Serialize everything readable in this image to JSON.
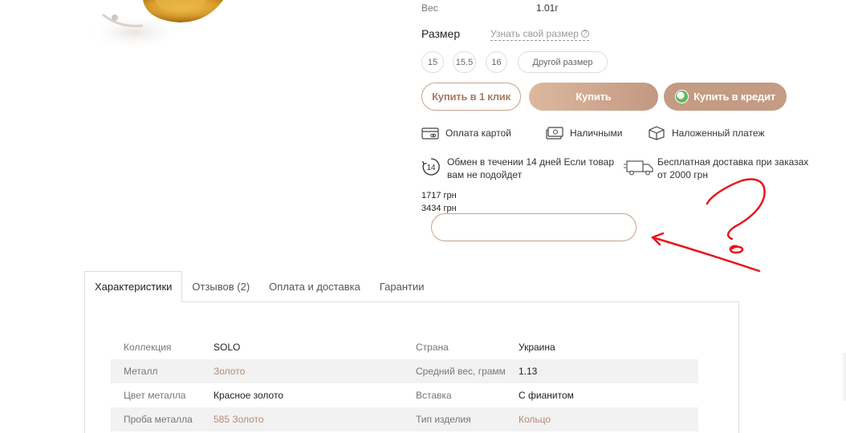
{
  "product": {
    "weight_label": "Вес",
    "weight_value": "1.01г"
  },
  "size": {
    "title": "Размер",
    "find_link": "Узнать свой размер",
    "options": [
      "15",
      "15.5",
      "16",
      "Другой размер"
    ]
  },
  "buttons": {
    "one_click": "Купить в 1 клик",
    "buy": "Купить",
    "credit": "Купить в кредит"
  },
  "payment": {
    "card": "Оплата картой",
    "cash": "Наличными",
    "cod": "Наложенный платеж"
  },
  "info": {
    "exchange_badge": "14",
    "exchange_line1": "Обмен в течении 14 дней Если товар",
    "exchange_line2": "вам не подойдет",
    "delivery_line1": "Бесплатная доставка при заказах",
    "delivery_line2": "от 2000 грн"
  },
  "prices": {
    "line1": "1717 грн",
    "line2": "3434 грн"
  },
  "tabs": [
    {
      "label": "Характеристики",
      "active": true
    },
    {
      "label": "Отзывов (2)",
      "active": false
    },
    {
      "label": "Оплата и доставка",
      "active": false
    },
    {
      "label": "Гарантии",
      "active": false
    }
  ],
  "specs": [
    {
      "k1": "Коллекция",
      "v1": "SOLO",
      "k2": "Страна",
      "v2": "Украина"
    },
    {
      "k1": "Металл",
      "v1": "Золото",
      "k2": "Средний вес, грамм",
      "v2": "1.13"
    },
    {
      "k1": "Цвет металла",
      "v1": "Красное золото",
      "k2": "Вставка",
      "v2": "С фианитом"
    },
    {
      "k1": "Проба металла",
      "v1": "585 Золото",
      "k2": "Тип изделия",
      "v2": "Кольцо"
    }
  ],
  "colors": {
    "accent": "#c49b83",
    "annotation": "#e8141b",
    "credit_icon": "#5db85c"
  }
}
